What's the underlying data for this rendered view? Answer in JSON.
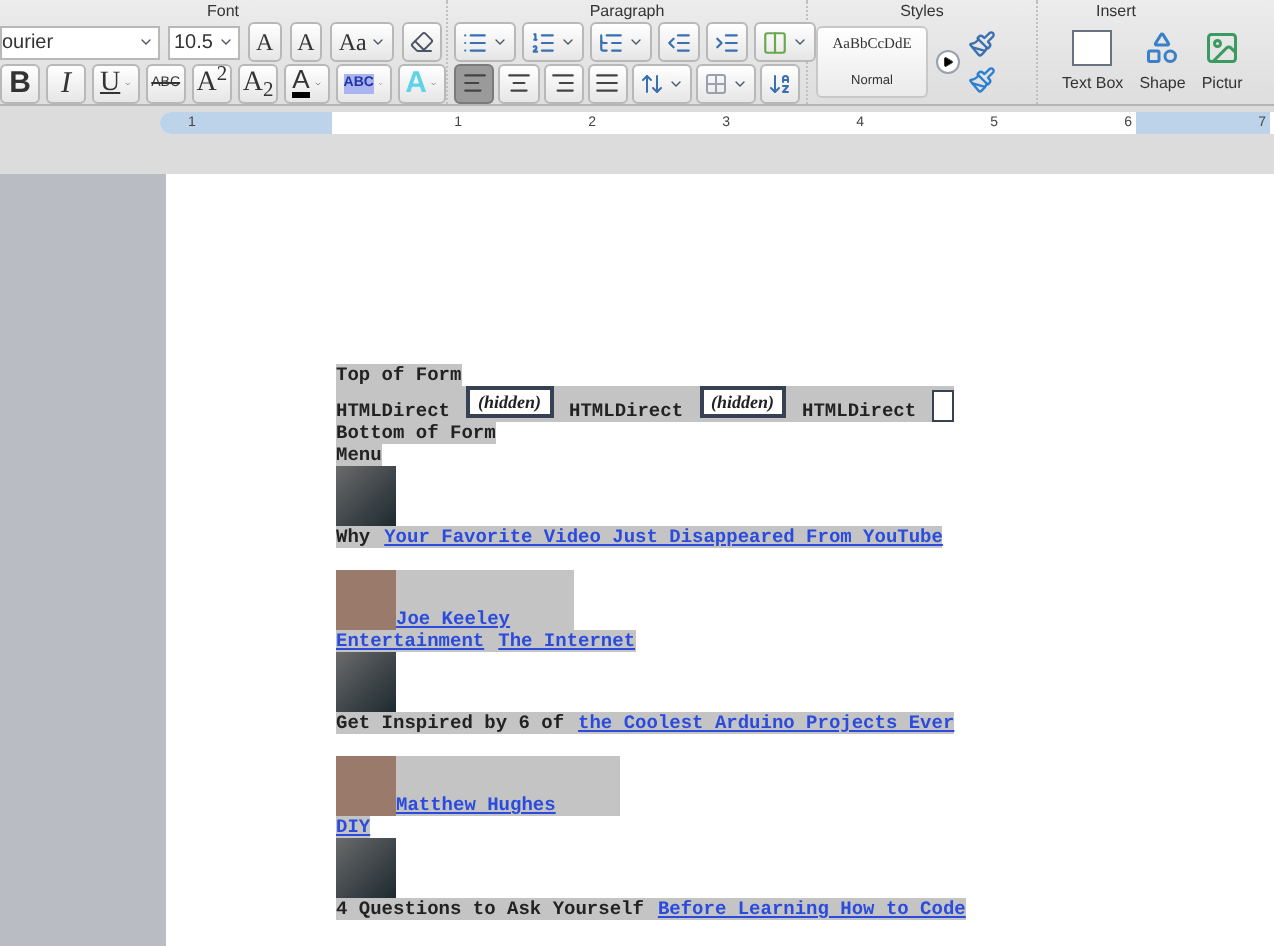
{
  "ribbon": {
    "font": {
      "label": "Font",
      "font_name": "ourier",
      "font_size": "10.5",
      "top_buttons": [
        {
          "kind": "grow",
          "label": "A"
        },
        {
          "kind": "shrink",
          "label": "A"
        },
        {
          "kind": "case",
          "label": "Aa"
        }
      ],
      "format_buttons": [
        {
          "kind": "bold",
          "label": "B"
        },
        {
          "kind": "italic",
          "label": "I"
        },
        {
          "kind": "underline",
          "label": "U"
        },
        {
          "kind": "strike",
          "label": "ABC"
        },
        {
          "kind": "super",
          "label": "A$^{2}$"
        },
        {
          "kind": "sub",
          "label": "A$_{2}$"
        },
        {
          "kind": "color",
          "label": "A"
        },
        {
          "kind": "highlight",
          "label": "ABC"
        },
        {
          "kind": "effects",
          "label": "A"
        }
      ]
    },
    "paragraph": {
      "label": "Paragraph",
      "alignment": [
        {
          "kind": "left",
          "selected": true
        },
        {
          "kind": "center",
          "selected": false
        },
        {
          "kind": "right",
          "selected": false
        },
        {
          "kind": "justify",
          "selected": false
        }
      ]
    },
    "styles": {
      "label": "Styles",
      "preview": "AaBbCcDdE",
      "style_name": "Normal"
    },
    "insert": {
      "label": "Insert",
      "items": [
        {
          "kind": "textbox",
          "label": "Text Box"
        },
        {
          "kind": "shape",
          "label": "Shape"
        },
        {
          "kind": "picture",
          "label": "Pictur"
        }
      ]
    }
  },
  "ruler": {
    "marks": [
      "1",
      "1",
      "2",
      "3",
      "4",
      "5",
      "6",
      "7"
    ]
  },
  "document": {
    "lines": [
      {
        "kind": "text",
        "text": "Top of Form"
      },
      {
        "kind": "form",
        "items": [
          {
            "kind": "label",
            "text": "HTMLDirect"
          },
          {
            "kind": "hidden",
            "text": "(hidden)"
          },
          {
            "kind": "label",
            "text": "HTMLDirect"
          },
          {
            "kind": "hidden",
            "text": "(hidden)"
          },
          {
            "kind": "label",
            "text": "HTMLDirect"
          },
          {
            "kind": "checkbox",
            "checked": false
          }
        ]
      },
      {
        "kind": "text",
        "text": "Bottom of Form"
      },
      {
        "kind": "text",
        "text": "Menu"
      },
      {
        "kind": "thumbnail"
      },
      {
        "kind": "headline",
        "text": "Why",
        "link": "Your Favorite Video Just Disappeared From YouTube"
      },
      {
        "kind": "author",
        "name": "Joe Keeley"
      },
      {
        "kind": "categories",
        "links": [
          "Entertainment",
          "The Internet"
        ]
      },
      {
        "kind": "thumbnail"
      },
      {
        "kind": "headline",
        "text": "Get Inspired by 6 of",
        "link": "the Coolest Arduino Projects Ever"
      },
      {
        "kind": "author",
        "name": "Matthew Hughes"
      },
      {
        "kind": "categories",
        "links": [
          "DIY"
        ]
      },
      {
        "kind": "thumbnail"
      },
      {
        "kind": "headline",
        "text": "4 Questions to Ask Yourself",
        "link": "Before Learning How to Code"
      }
    ]
  }
}
